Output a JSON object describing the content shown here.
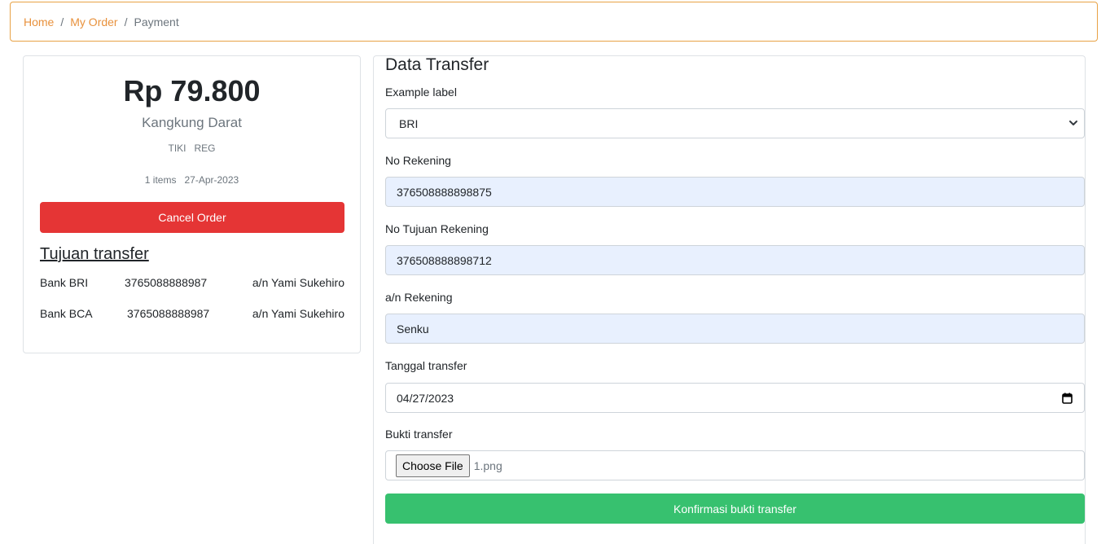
{
  "breadcrumb": {
    "home": "Home",
    "my_order": "My Order",
    "current": "Payment",
    "separator": "/"
  },
  "order": {
    "price": "Rp 79.800",
    "product": "Kangkung Darat",
    "courier": "TIKI",
    "service": "REG",
    "items": "1 items",
    "date": "27-Apr-2023",
    "cancel_label": "Cancel Order"
  },
  "transfer_destination": {
    "heading": "Tujuan transfer",
    "banks": [
      {
        "name": "Bank BRI",
        "account": "3765088888987",
        "holder": "a/n Yami Sukehiro"
      },
      {
        "name": "Bank BCA",
        "account": "3765088888987",
        "holder": "a/n Yami Sukehiro"
      }
    ]
  },
  "form": {
    "title": "Data Transfer",
    "bank_select": {
      "label": "Example label",
      "value": "BRI"
    },
    "account_no": {
      "label": "No Rekening",
      "value": "376508888898875"
    },
    "target_account": {
      "label": "No Tujuan Rekening",
      "value": "376508888898712"
    },
    "account_name": {
      "label": "a/n Rekening",
      "value": "Senku"
    },
    "transfer_date": {
      "label": "Tanggal transfer",
      "value": "04/27/2023"
    },
    "proof": {
      "label": "Bukti transfer",
      "button": "Choose File",
      "filename": "1.png"
    },
    "submit_label": "Konfirmasi bukti transfer"
  },
  "colors": {
    "accent": "#e8913c",
    "danger": "#e53535",
    "success": "#37c16f",
    "autofill": "#e8f0fe"
  }
}
